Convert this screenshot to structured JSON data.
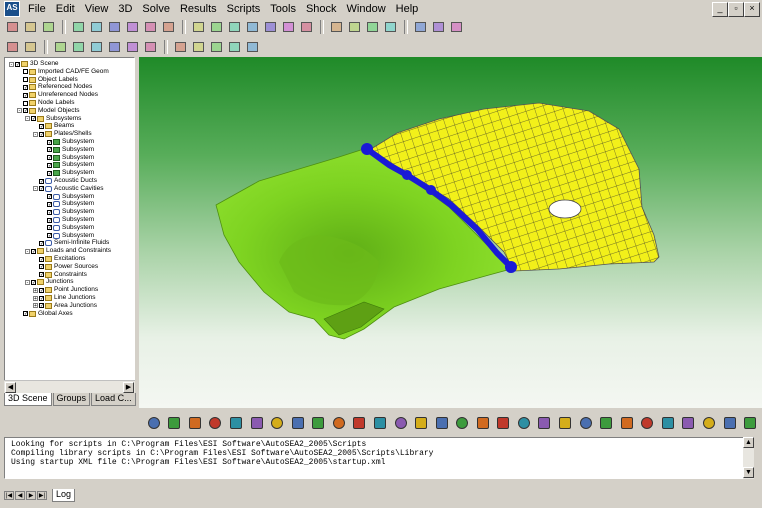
{
  "menu": {
    "items": [
      "File",
      "Edit",
      "View",
      "3D",
      "Solve",
      "Results",
      "Scripts",
      "Tools",
      "Shock",
      "Window",
      "Help"
    ],
    "app_icon": "AS"
  },
  "window_controls": {
    "minimize": "_",
    "restore": "▫",
    "close": "×"
  },
  "tree": {
    "rows": [
      {
        "label": "3D Scene",
        "depth": 0,
        "icon": "folder",
        "check": "✓",
        "expand": "-"
      },
      {
        "label": "Imported CAD/FE Geom",
        "depth": 1,
        "icon": "folder",
        "check": "",
        "expand": ""
      },
      {
        "label": "Object Labels",
        "depth": 1,
        "icon": "folder",
        "check": "",
        "expand": ""
      },
      {
        "label": "Referenced Nodes",
        "depth": 1,
        "icon": "folder",
        "check": "✓",
        "expand": ""
      },
      {
        "label": "Unreferenced Nodes",
        "depth": 1,
        "icon": "folder",
        "check": "✓",
        "expand": ""
      },
      {
        "label": "Node Labels",
        "depth": 1,
        "icon": "folder",
        "check": "",
        "expand": ""
      },
      {
        "label": "Model Objects",
        "depth": 1,
        "icon": "folder",
        "check": "✓",
        "expand": "-"
      },
      {
        "label": "Subsystems",
        "depth": 2,
        "icon": "folder",
        "check": "✓",
        "expand": "-"
      },
      {
        "label": "Beams",
        "depth": 3,
        "icon": "folder",
        "check": "✓",
        "expand": ""
      },
      {
        "label": "Plates/Shells",
        "depth": 3,
        "icon": "folder",
        "check": "✓",
        "expand": "-"
      },
      {
        "label": "Subsystem",
        "depth": 4,
        "icon": "sub",
        "check": "✓",
        "expand": ""
      },
      {
        "label": "Subsystem",
        "depth": 4,
        "icon": "sub",
        "check": "✓",
        "expand": ""
      },
      {
        "label": "Subsystem",
        "depth": 4,
        "icon": "sub",
        "check": "✓",
        "expand": ""
      },
      {
        "label": "Subsystem",
        "depth": 4,
        "icon": "sub",
        "check": "✓",
        "expand": ""
      },
      {
        "label": "Subsystem",
        "depth": 4,
        "icon": "sub",
        "check": "✓",
        "expand": ""
      },
      {
        "label": "Acoustic Ducts",
        "depth": 3,
        "icon": "cav",
        "check": "✓",
        "expand": ""
      },
      {
        "label": "Acoustic Cavities",
        "depth": 3,
        "icon": "cav",
        "check": "✓",
        "expand": "-"
      },
      {
        "label": "Subsystem",
        "depth": 4,
        "icon": "cav",
        "check": "✓",
        "expand": ""
      },
      {
        "label": "Subsystem",
        "depth": 4,
        "icon": "cav",
        "check": "✓",
        "expand": ""
      },
      {
        "label": "Subsystem",
        "depth": 4,
        "icon": "cav",
        "check": "✓",
        "expand": ""
      },
      {
        "label": "Subsystem",
        "depth": 4,
        "icon": "cav",
        "check": "✓",
        "expand": ""
      },
      {
        "label": "Subsystem",
        "depth": 4,
        "icon": "cav",
        "check": "✓",
        "expand": ""
      },
      {
        "label": "Subsystem",
        "depth": 4,
        "icon": "cav",
        "check": "✓",
        "expand": ""
      },
      {
        "label": "Semi-Infinite Fluids",
        "depth": 3,
        "icon": "cav",
        "check": "✓",
        "expand": ""
      },
      {
        "label": "Loads and Constraints",
        "depth": 2,
        "icon": "folder",
        "check": "✓",
        "expand": "-"
      },
      {
        "label": "Excitations",
        "depth": 3,
        "icon": "folder",
        "check": "✓",
        "expand": ""
      },
      {
        "label": "Power Sources",
        "depth": 3,
        "icon": "folder",
        "check": "✓",
        "expand": ""
      },
      {
        "label": "Constraints",
        "depth": 3,
        "icon": "folder",
        "check": "✓",
        "expand": ""
      },
      {
        "label": "Junctions",
        "depth": 2,
        "icon": "folder",
        "check": "✓",
        "expand": "-"
      },
      {
        "label": "Point Junctions",
        "depth": 3,
        "icon": "folder",
        "check": "✓",
        "expand": "+"
      },
      {
        "label": "Line Junctions",
        "depth": 3,
        "icon": "folder",
        "check": "✓",
        "expand": "+"
      },
      {
        "label": "Area Junctions",
        "depth": 3,
        "icon": "folder",
        "check": "✓",
        "expand": "+"
      },
      {
        "label": "Global Axes",
        "depth": 1,
        "icon": "folder",
        "check": "✓",
        "expand": ""
      }
    ]
  },
  "left_tabs": [
    "3D Scene",
    "Groups",
    "Load C..."
  ],
  "log": {
    "lines": [
      "Looking for scripts in C:\\Program Files\\ESI Software\\AutoSEA2_2005\\Scripts",
      "Compiling library scripts in C:\\Program Files\\ESI Software\\AutoSEA2_2005\\Scripts\\Library",
      "Using startup XML file C:\\Program Files\\ESI Software\\AutoSEA2_2005\\startup.xml"
    ],
    "tab": "Log"
  },
  "colors": {
    "plate_green": "#7ed321",
    "plate_yellow": "#f2f01a",
    "junction_blue": "#1a1ad6",
    "mesh_line": "#2a2a2a"
  },
  "icons": {
    "toolbar1": [
      "new-icon",
      "open-icon",
      "save-icon",
      "print-icon",
      "copy-icon",
      "paste-icon",
      "cut-icon",
      "undo-icon",
      "redo-icon",
      "list-icon",
      "grid-icon",
      "grid-icon",
      "grid-icon",
      "grid-icon",
      "grid-icon",
      "grid-icon",
      "solve-icon",
      "table-icon",
      "plot-icon",
      "graph-icon",
      "run-icon",
      "stop-icon",
      "help-icon"
    ],
    "toolbar2": [
      "select-icon",
      "pointer-icon",
      "rotate-icon",
      "pan-icon",
      "move-icon",
      "zoom-in-icon",
      "zoom-out-icon",
      "fit-icon",
      "split-icon",
      "camera-icon",
      "pick-icon",
      "tree-icon",
      "layers-icon"
    ],
    "viewbar": [
      "beam-icon",
      "ibeam-icon",
      "ring-icon",
      "plate-icon",
      "curved-plate-icon",
      "cylinder-icon",
      "dome-icon",
      "tube-icon",
      "box-icon",
      "half-dome-icon",
      "burst-icon",
      "hand-icon",
      "duct-icon",
      "panel-icon",
      "junction-icon",
      "cable-icon",
      "point-icon",
      "hand-point-icon",
      "flag-icon",
      "arrow-down-icon",
      "area-icon",
      "line-junction-icon",
      "area-junction-icon",
      "wave-icon",
      "surface-icon",
      "grid-surface-icon",
      "layer-icon",
      "person-icon",
      "plane-icon",
      "mesh-icon"
    ]
  }
}
